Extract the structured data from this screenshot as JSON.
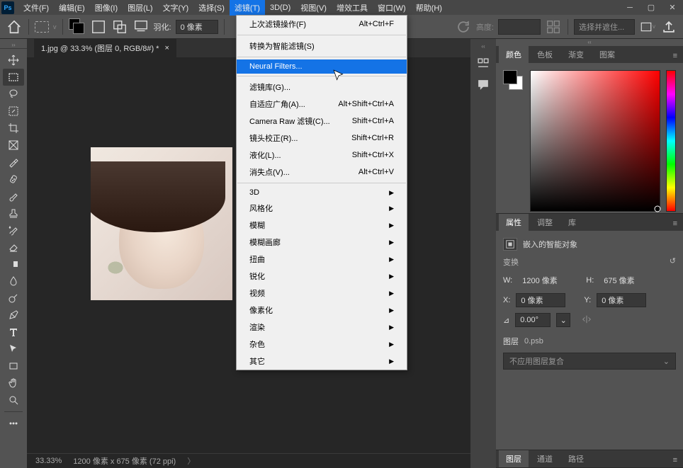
{
  "menubar": {
    "items": [
      "文件(F)",
      "编辑(E)",
      "图像(I)",
      "图层(L)",
      "文字(Y)",
      "选择(S)",
      "滤镜(T)",
      "3D(D)",
      "视图(V)",
      "增效工具",
      "窗口(W)",
      "帮助(H)"
    ]
  },
  "optbar": {
    "feather_label": "羽化:",
    "feather_value": "0 像素",
    "height_label": "高度:",
    "select_mask": "选择并遮住..."
  },
  "doc": {
    "tab_title": "1.jpg @ 33.3% (图层 0, RGB/8#) *"
  },
  "dropdown": {
    "items": [
      {
        "label": "上次滤镜操作(F)",
        "short": "Alt+Ctrl+F",
        "sep": true
      },
      {
        "label": "转换为智能滤镜(S)",
        "short": "",
        "sep": true
      },
      {
        "label": "Neural Filters...",
        "short": "",
        "hl": true,
        "sep": true
      },
      {
        "label": "滤镜库(G)...",
        "short": ""
      },
      {
        "label": "自适应广角(A)...",
        "short": "Alt+Shift+Ctrl+A"
      },
      {
        "label": "Camera Raw 滤镜(C)...",
        "short": "Shift+Ctrl+A"
      },
      {
        "label": "镜头校正(R)...",
        "short": "Shift+Ctrl+R"
      },
      {
        "label": "液化(L)...",
        "short": "Shift+Ctrl+X"
      },
      {
        "label": "消失点(V)...",
        "short": "Alt+Ctrl+V",
        "sep": true
      },
      {
        "label": "3D",
        "sub": true
      },
      {
        "label": "风格化",
        "sub": true
      },
      {
        "label": "模糊",
        "sub": true
      },
      {
        "label": "模糊画廊",
        "sub": true
      },
      {
        "label": "扭曲",
        "sub": true
      },
      {
        "label": "锐化",
        "sub": true
      },
      {
        "label": "视频",
        "sub": true
      },
      {
        "label": "像素化",
        "sub": true
      },
      {
        "label": "渲染",
        "sub": true
      },
      {
        "label": "杂色",
        "sub": true
      },
      {
        "label": "其它",
        "sub": true
      }
    ]
  },
  "panels": {
    "color": {
      "tabs": [
        "颜色",
        "色板",
        "渐变",
        "图案"
      ]
    },
    "props": {
      "tabs": [
        "属性",
        "调整",
        "库"
      ],
      "obj_label": "嵌入的智能对象",
      "transform": "变换",
      "w_label": "W:",
      "w_val": "1200 像素",
      "h_label": "H:",
      "h_val": "675 像素",
      "x_label": "X:",
      "x_val": "0 像素",
      "y_label": "Y:",
      "y_val": "0 像素",
      "angle": "0.00°",
      "layer_label": "图层",
      "layer_val": "0.psb",
      "comp_placeholder": "不应用图层复合"
    },
    "layers": {
      "tabs": [
        "图层",
        "通道",
        "路径"
      ]
    }
  },
  "status": {
    "zoom": "33.33%",
    "dims": "1200 像素 x 675 像素 (72 ppi)"
  }
}
